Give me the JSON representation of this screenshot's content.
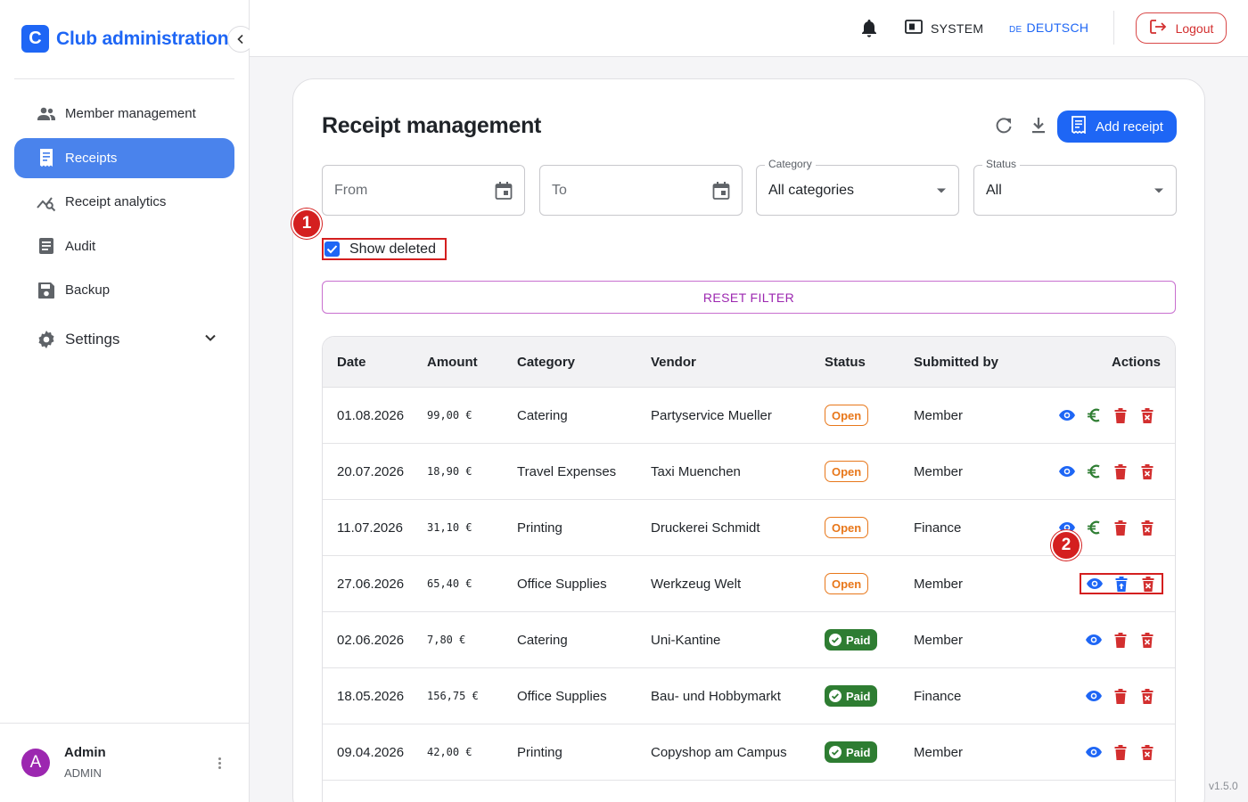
{
  "brand": {
    "logo_letter": "C",
    "title": "Club administration"
  },
  "sidebar": {
    "items": [
      {
        "label": "Member management",
        "icon": "people-icon",
        "active": false
      },
      {
        "label": "Receipts",
        "icon": "receipt-icon",
        "active": true
      },
      {
        "label": "Receipt analytics",
        "icon": "analytics-icon",
        "active": false
      },
      {
        "label": "Audit",
        "icon": "document-icon",
        "active": false
      },
      {
        "label": "Backup",
        "icon": "save-icon",
        "active": false
      }
    ],
    "settings_label": "Settings"
  },
  "user": {
    "avatar_letter": "A",
    "name": "Admin",
    "role": "ADMIN"
  },
  "topbar": {
    "system_label": "SYSTEM",
    "lang_code": "DE",
    "lang_label": "DEUTSCH",
    "logout_label": "Logout"
  },
  "page": {
    "title": "Receipt management",
    "add_label": "Add receipt"
  },
  "filters": {
    "from_placeholder": "From",
    "to_placeholder": "To",
    "category_label": "Category",
    "category_value": "All categories",
    "status_label": "Status",
    "status_value": "All",
    "show_deleted_label": "Show deleted",
    "show_deleted_checked": true,
    "reset_label": "RESET FILTER"
  },
  "annotations": {
    "one": "1",
    "two": "2"
  },
  "table": {
    "headers": {
      "date": "Date",
      "amount": "Amount",
      "category": "Category",
      "vendor": "Vendor",
      "status": "Status",
      "submitted_by": "Submitted by",
      "actions": "Actions"
    },
    "rows": [
      {
        "date": "01.08.2026",
        "amount": "99,00 €",
        "category": "Catering",
        "vendor": "Partyservice Mueller",
        "status": "Open",
        "submitted_by": "Member"
      },
      {
        "date": "20.07.2026",
        "amount": "18,90 €",
        "category": "Travel Expenses",
        "vendor": "Taxi Muenchen",
        "status": "Open",
        "submitted_by": "Member"
      },
      {
        "date": "11.07.2026",
        "amount": "31,10 €",
        "category": "Printing",
        "vendor": "Druckerei Schmidt",
        "status": "Open",
        "submitted_by": "Finance"
      },
      {
        "date": "27.06.2026",
        "amount": "65,40 €",
        "category": "Office Supplies",
        "vendor": "Werkzeug Welt",
        "status": "Open",
        "submitted_by": "Member"
      },
      {
        "date": "02.06.2026",
        "amount": "7,80 €",
        "category": "Catering",
        "vendor": "Uni-Kantine",
        "status": "Paid",
        "submitted_by": "Member"
      },
      {
        "date": "18.05.2026",
        "amount": "156,75 €",
        "category": "Office Supplies",
        "vendor": "Bau- und Hobbymarkt",
        "status": "Paid",
        "submitted_by": "Finance"
      },
      {
        "date": "09.04.2026",
        "amount": "42,00 €",
        "category": "Printing",
        "vendor": "Copyshop am Campus",
        "status": "Paid",
        "submitted_by": "Member"
      }
    ]
  },
  "version": "v1.5.0",
  "colors": {
    "primary": "#1e66f5",
    "danger": "#d32f2f",
    "open": "#e8771a",
    "paid": "#2e7d32",
    "reset": "#9c27b0",
    "pay": "#2e7d32"
  }
}
